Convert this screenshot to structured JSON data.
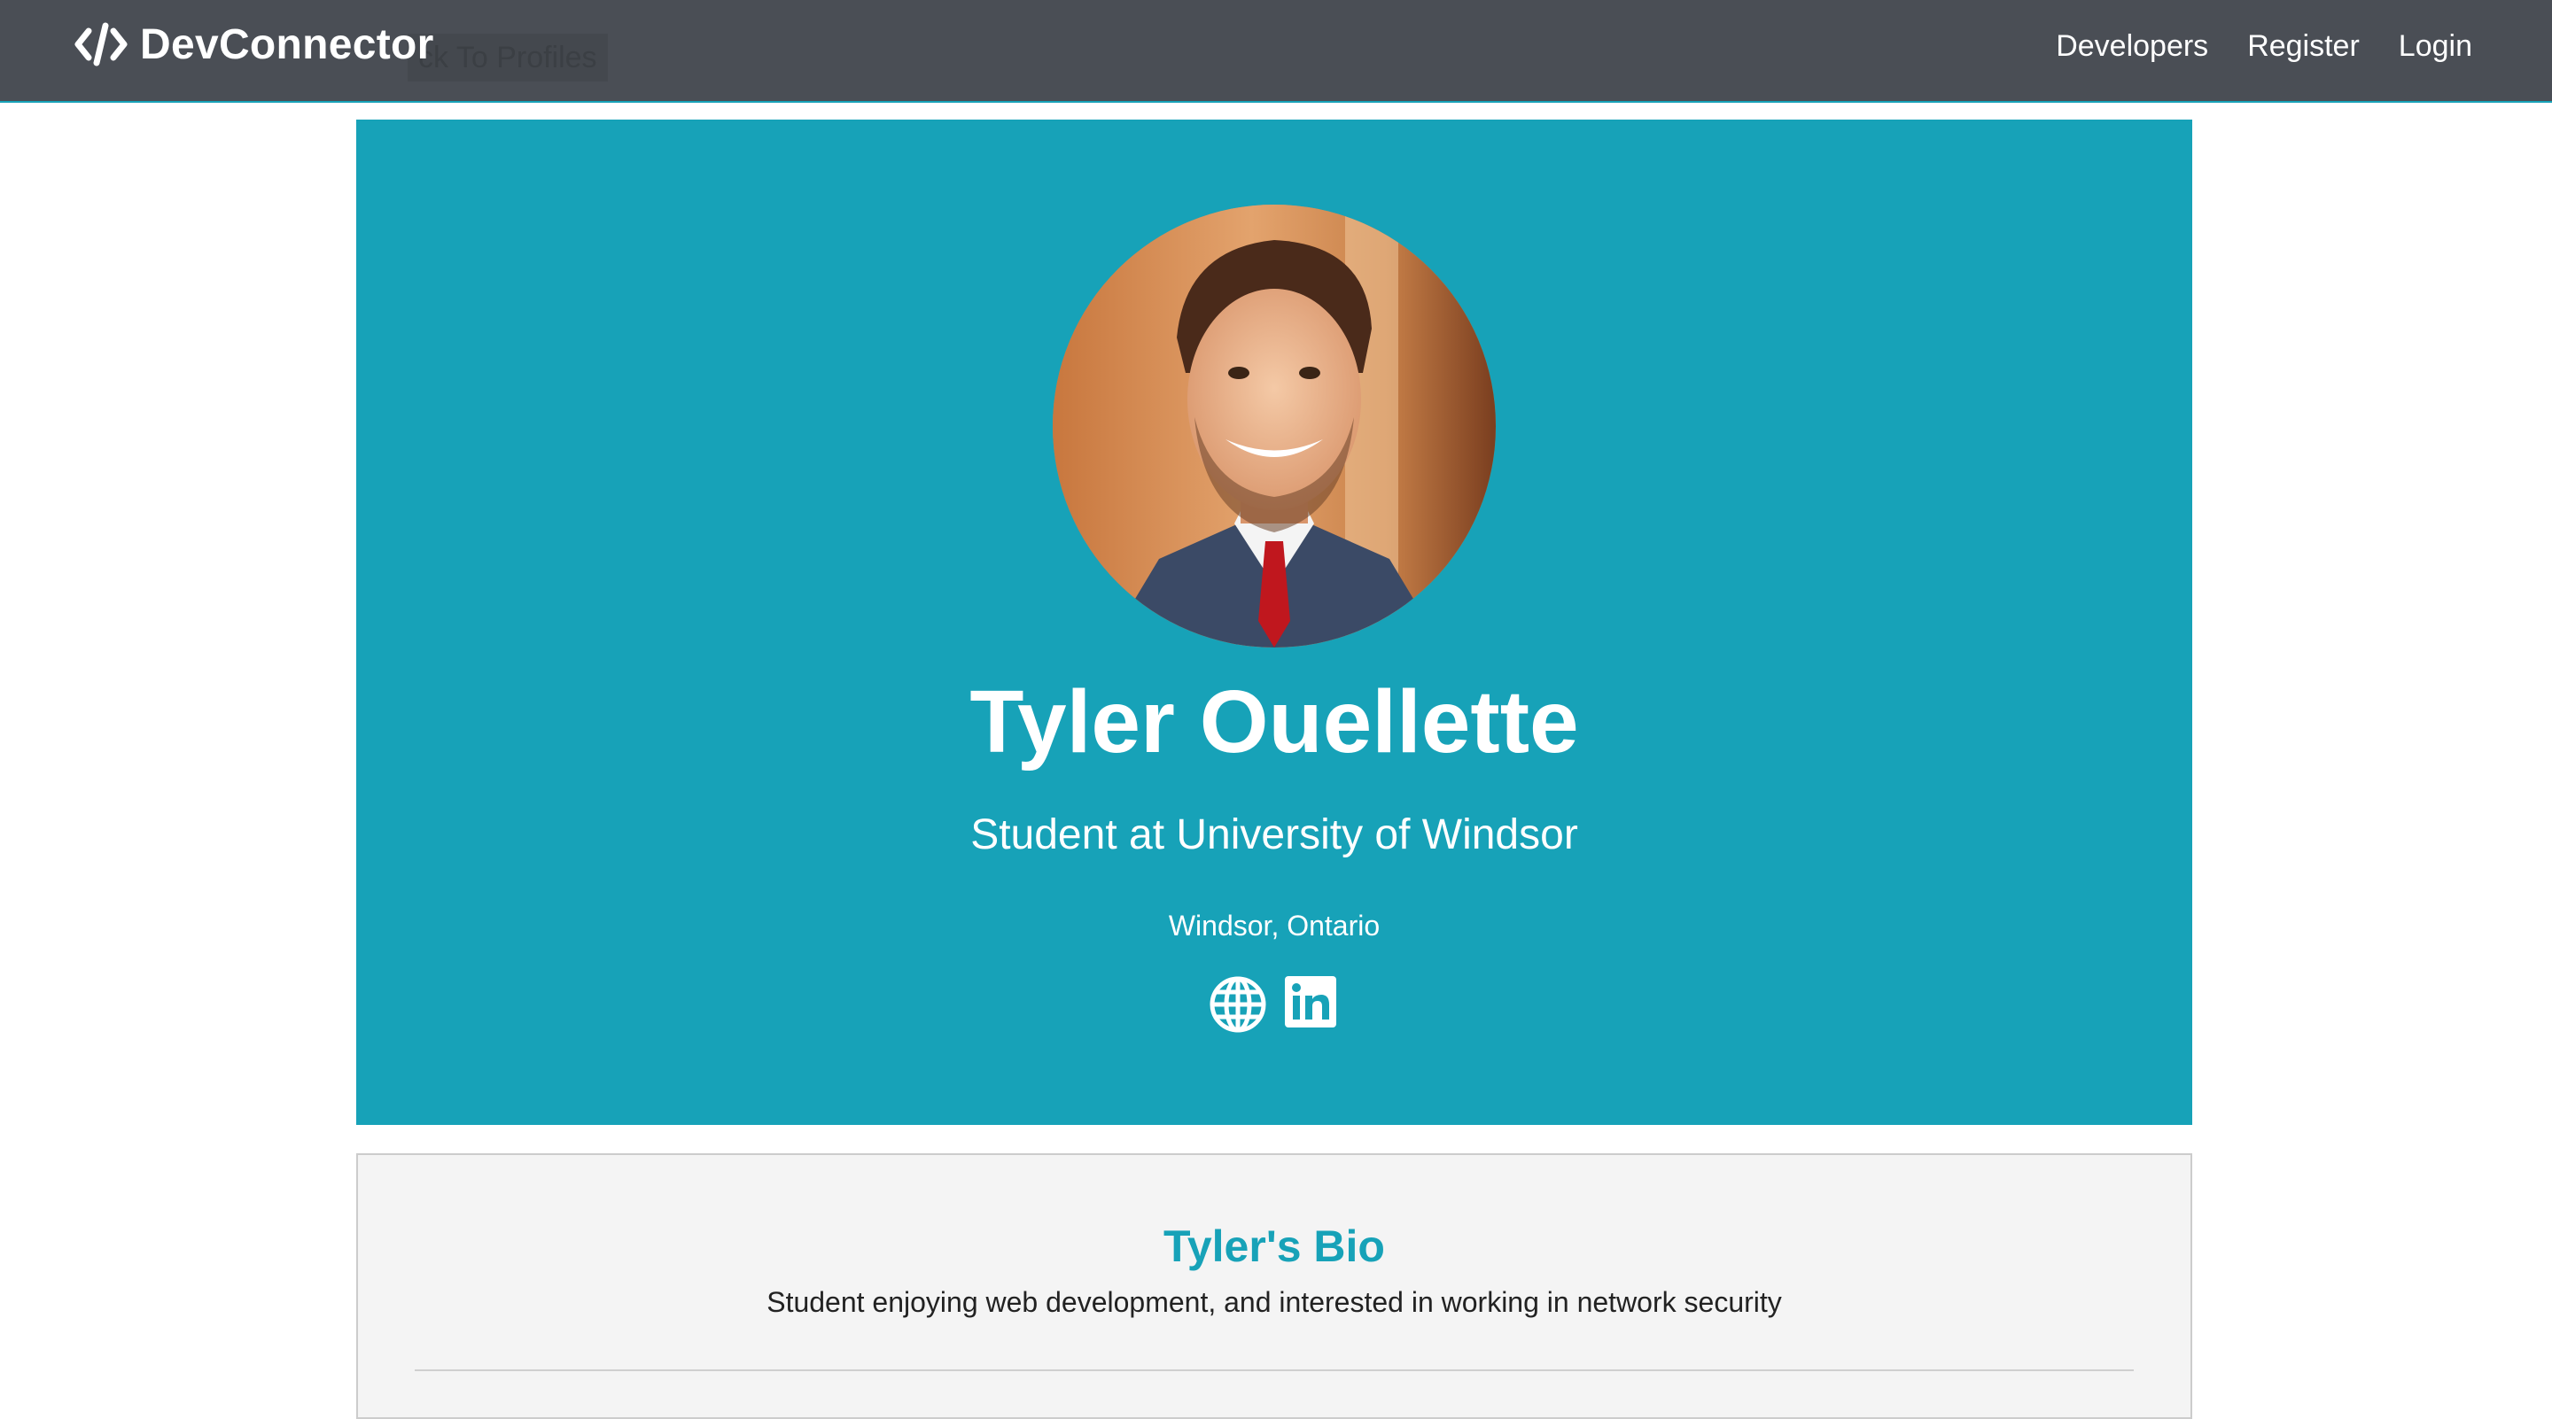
{
  "colors": {
    "navbar_bg": "#4a4e55",
    "primary": "#17a2b8",
    "bio_bg": "#f4f4f4"
  },
  "navbar": {
    "brand_icon": "code-icon",
    "brand_label": "DevConnector",
    "back_button_label": "ck To Profiles",
    "links": [
      {
        "label": "Developers"
      },
      {
        "label": "Register"
      },
      {
        "label": "Login"
      }
    ]
  },
  "profile": {
    "name": "Tyler Ouellette",
    "status": "Student at University of Windsor",
    "location": "Windsor, Ontario",
    "social_icons": [
      "globe-icon",
      "linkedin-icon"
    ]
  },
  "bio": {
    "title": "Tyler's Bio",
    "text": "Student enjoying web development, and interested in working in network security"
  }
}
